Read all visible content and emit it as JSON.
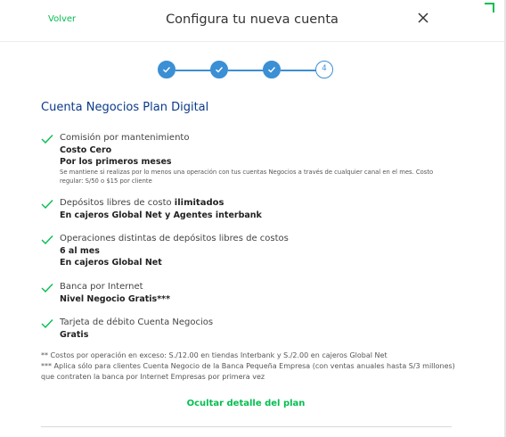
{
  "header": {
    "back_label": "Volver",
    "title": "Configura tu nueva cuenta"
  },
  "stepper": {
    "current_step": "4",
    "total_steps": 4,
    "completed_steps": 3
  },
  "plan": {
    "title": "Cuenta Negocios Plan Digital",
    "items": [
      {
        "label": "Comisión por mantenimiento",
        "bold_lines": [
          "Costo Cero",
          "Por los primeros meses"
        ],
        "note": "Se mantiene si realizas por lo menos una operación con tus cuentas Negocios a través de cualquier canal en el mes. Costo regular: S/50 o $15 por cliente"
      },
      {
        "label_prefix": "Depósitos libres de costo ",
        "label_bold": "ilimitados",
        "bold_lines": [
          "En cajeros Global Net y Agentes interbank"
        ]
      },
      {
        "label": "Operaciones distintas de depósitos libres de costos",
        "bold_lines": [
          "6 al mes",
          "En cajeros Global Net"
        ]
      },
      {
        "label": "Banca por Internet",
        "bold_lines": [
          "Nivel Negocio Gratis***"
        ]
      },
      {
        "label": "Tarjeta de débito Cuenta Negocios",
        "bold_lines": [
          "Gratis"
        ]
      }
    ],
    "footnotes": [
      "** Costos por operación en exceso: S./12.00 en tiendas Interbank y S./2.00 en cajeros Global Net",
      "*** Aplica sólo para clientes Cuenta Negocio de la Banca Pequeña Empresa (con ventas anuales hasta S/3 millones) que contraten la banca por Internet Empresas por primera vez"
    ],
    "toggle_label": "Ocultar detalle del plan"
  },
  "colors": {
    "accent_green": "#05be50",
    "step_blue": "#3b8fd4",
    "title_navy": "#0a3a8a"
  },
  "icons": {
    "close": "close-icon",
    "check": "check-icon",
    "step_check": "step-check-icon"
  }
}
